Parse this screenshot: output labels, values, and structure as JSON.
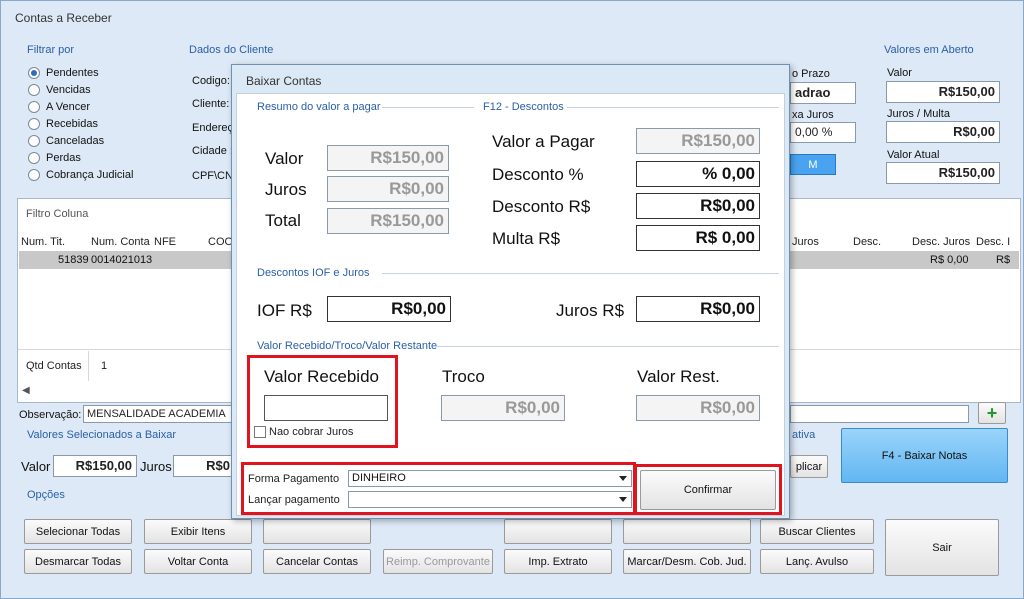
{
  "window": {
    "title": "Contas a Receber"
  },
  "filter": {
    "group": "Filtrar por",
    "options": [
      "Pendentes",
      "Vencidas",
      "A Vencer",
      "Recebidas",
      "Canceladas",
      "Perdas",
      "Cobrança Judicial"
    ],
    "selected": "Pendentes"
  },
  "client": {
    "group": "Dados do Cliente",
    "fields": [
      "Codigo:",
      "Cliente:",
      "Endereç",
      "Cidade :",
      "CPF\\CNP"
    ]
  },
  "terms": {
    "prazo_label": "o Prazo",
    "prazo_value": "adrao",
    "juros_label": "xa Juros",
    "juros_value": "0,00 %",
    "m_button": "M"
  },
  "open_values": {
    "group": "Valores em Aberto",
    "valor_label": "Valor",
    "valor": "R$150,00",
    "juros_label": "Juros / Multa",
    "juros": "R$0,00",
    "atual_label": "Valor Atual",
    "atual": "R$150,00"
  },
  "grid": {
    "filter_label": "Filtro Coluna",
    "headers_left": [
      "Num. Tit.",
      "Num. Conta",
      "NFE",
      "COO"
    ],
    "headers_right": [
      "Juros",
      "Desc.",
      "Desc. Juros",
      "Desc. I"
    ],
    "row_left": [
      "51839",
      "0014021013"
    ],
    "row_right": [
      "R$ 0,00",
      "R$"
    ],
    "qtd_label": "Qtd Contas",
    "qtd": "1"
  },
  "obs": {
    "label": "Observação:",
    "value": "MENSALIDADE ACADEMIA",
    "add_icon": "plus-icon"
  },
  "selected": {
    "group": "Valores Selecionados a Baixar",
    "valor_label": "Valor",
    "valor": "R$150,00",
    "juros_label": "Juros",
    "juros": "R$0"
  },
  "right_partial": {
    "label": "ativa",
    "plicar": "plicar",
    "baixar_notas": "F4 - Baixar Notas"
  },
  "options": {
    "group": "Opções",
    "row1": [
      "Selecionar Todas",
      "Exibir Itens",
      "",
      "",
      "",
      "",
      "Buscar Clientes"
    ],
    "row2": [
      "Desmarcar Todas",
      "Voltar Conta",
      "Cancelar Contas",
      "Reimp. Comprovante",
      "Imp. Extrato",
      "Marcar/Desm. Cob. Jud.",
      "Lanç. Avulso"
    ],
    "sair": "Sair"
  },
  "dialog": {
    "title": "Baixar Contas",
    "resumo": "Resumo do valor a pagar",
    "descontos": "F12 - Descontos",
    "valor_label": "Valor",
    "valor": "R$150,00",
    "juros_label": "Juros",
    "juros": "R$0,00",
    "total_label": "Total",
    "total": "R$150,00",
    "valor_pagar_label": "Valor a Pagar",
    "valor_pagar": "R$150,00",
    "desc_pct_label": "Desconto %",
    "desc_pct": "% 0,00",
    "desc_rs_label": "Desconto R$",
    "desc_rs": "R$0,00",
    "multa_label": "Multa R$",
    "multa": "R$ 0,00",
    "iof_section": "Descontos IOF e Juros",
    "iof_label": "IOF R$",
    "iof": "R$0,00",
    "juros_rs_label": "Juros R$",
    "juros_rs": "R$0,00",
    "receb_section": "Valor Recebido/Troco/Valor Restante",
    "recebido_label": "Valor Recebido",
    "recebido": "",
    "nao_cobrar": "Nao cobrar Juros",
    "troco_label": "Troco",
    "troco": "R$0,00",
    "rest_label": "Valor Rest.",
    "rest": "R$0,00",
    "forma_label": "Forma Pagamento",
    "forma": "DINHEIRO",
    "lancar_label": "Lançar pagamento",
    "lancar": "",
    "confirmar": "Confirmar"
  }
}
